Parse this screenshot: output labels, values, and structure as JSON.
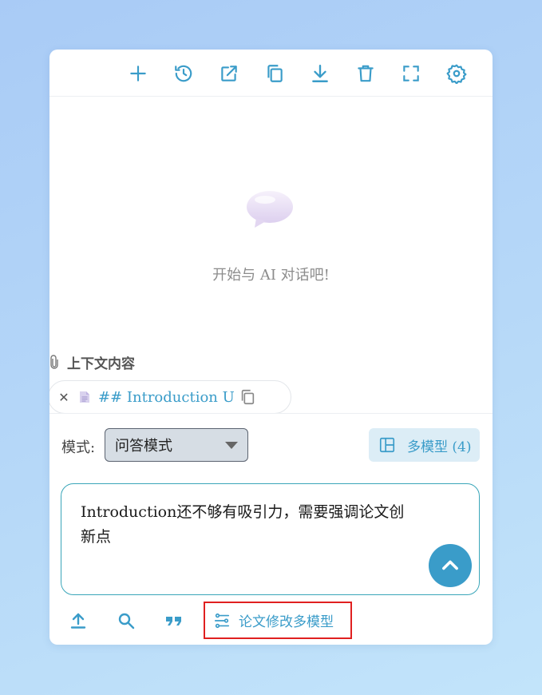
{
  "toolbar": {
    "icons": [
      "plus-icon",
      "history-icon",
      "open-external-icon",
      "copy-icon",
      "download-icon",
      "trash-icon",
      "fullscreen-icon",
      "gear-icon"
    ]
  },
  "empty_state": {
    "message": "开始与 AI 对话吧!",
    "icon": "chat-bubble-icon"
  },
  "context": {
    "title": "上下文内容",
    "chip_text": "## Introduction Und..."
  },
  "mode": {
    "label": "模式:",
    "selected": "问答模式"
  },
  "multi_model": {
    "label": "多模型 (4)"
  },
  "input": {
    "value": "Introduction还不够有吸引力，需要强调论文创新点"
  },
  "bottom": {
    "preset_label": "论文修改多模型"
  },
  "colors": {
    "accent": "#3a9cc9",
    "highlight_border": "#e02020"
  }
}
